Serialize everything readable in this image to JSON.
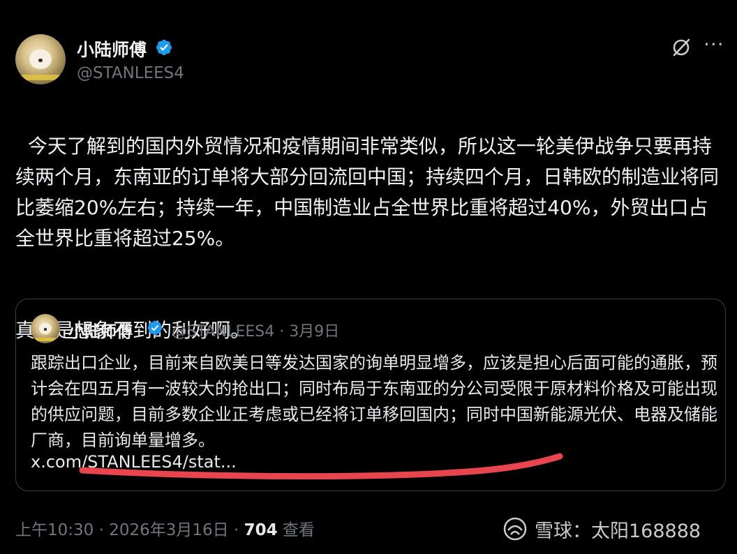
{
  "author": {
    "name": "小陆师傅",
    "handle": "@STANLEES4"
  },
  "tweet": {
    "text": "今天了解到的国内外贸情况和疫情期间非常类似，所以这一轮美伊战争只要再持续两个月，东南亚的订单将大部分回流回中国；持续四个月，日韩欧的制造业将同比萎缩20%左右；持续一年，中国制造业占全世界比重将超过40%，外贸出口占全世界比重将超过25%。",
    "text2": "真的是想象不到的利好啊。"
  },
  "quote": {
    "name": "小陆师傅",
    "meta": "@STANLEES4 · 3月9日",
    "text": "跟踪出口企业，目前来自欧美日等发达国家的询单明显增多，应该是担心后面可能的通胀，预计会在四五月有一波较大的抢出口；同时布局于东南亚的分公司受限于原材料价格及可能出现的供应问题，目前多数企业正考虑或已经将订单移回国内；同时中国新能源光伏、电器及储能厂商，目前询单量增多。",
    "link": "x.com/STANLEES4/stat..."
  },
  "footer": {
    "time_date": "上午10:30 · 2026年3月16日 · ",
    "views": "704",
    "views_label": " 查看"
  },
  "watermark": {
    "text": "雪球：太阳168888"
  },
  "colors": {
    "background": "#000000",
    "verified": "#1d9bf0",
    "underline": "#e8454f",
    "muted": "#71767b"
  }
}
